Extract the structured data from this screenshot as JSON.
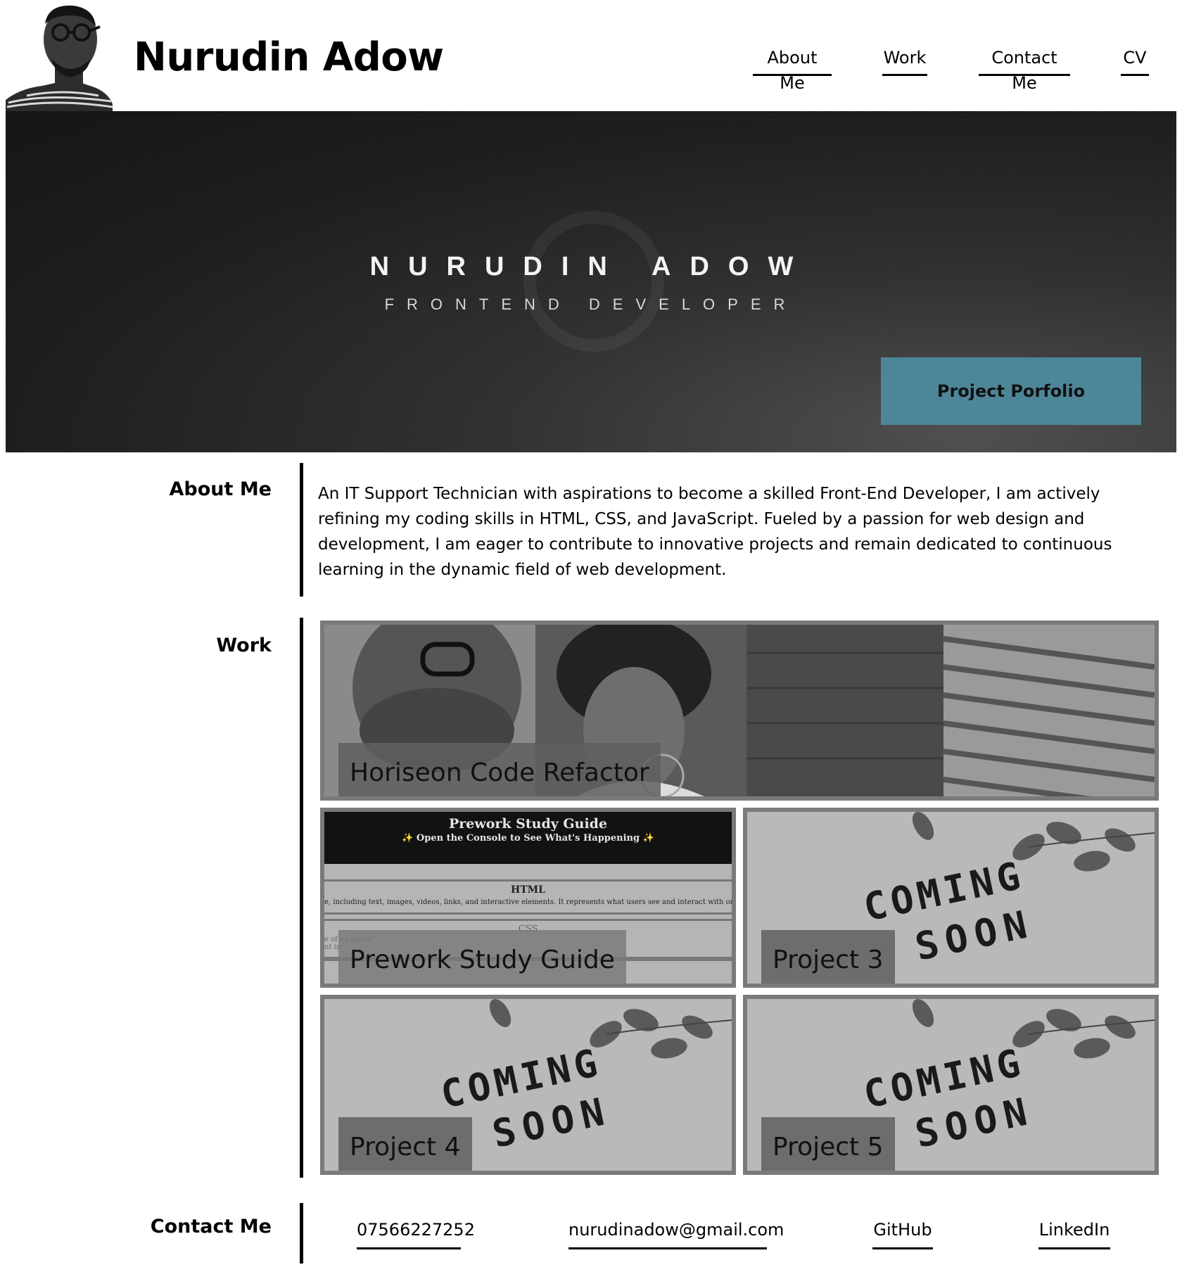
{
  "header": {
    "title": "Nurudin Adow",
    "nav": [
      "About Me",
      "Work",
      "Contact Me",
      "CV"
    ]
  },
  "hero": {
    "name": "NURUDIN ADOW",
    "role": "FRONTEND DEVELOPER",
    "cta_label": "Project Porfolio",
    "cta_color": "#4e8699"
  },
  "about": {
    "heading": "About Me",
    "text": "An IT Support Technician with aspirations to become a skilled Front-End Developer, I am actively refining my coding skills in HTML, CSS, and JavaScript. Fueled by a passion for web design and development, I am eager to contribute to innovative projects and remain dedicated to continuous learning in the dynamic field of web development."
  },
  "work": {
    "heading": "Work",
    "projects": [
      {
        "title": "Horiseon Code Refactor"
      },
      {
        "title": "Prework Study Guide",
        "preview": {
          "title": "Prework Study Guide",
          "subtitle": "✨ Open the Console to See What's Happening ✨",
          "section1": "HTML",
          "section1_text": "e, including text, images, videos, links, and interactive elements. It represents what users see and interact with on the w",
          "section2": "CSS",
          "section2_text_1": "e of its layout",
          "section2_text_2": "nt in"
        }
      },
      {
        "title": "Project 3",
        "image_text": [
          "COMING",
          "SOON"
        ]
      },
      {
        "title": "Project 4",
        "image_text": [
          "COMING",
          "SOON"
        ]
      },
      {
        "title": "Project 5",
        "image_text": [
          "COMING",
          "SOON"
        ]
      }
    ]
  },
  "contact": {
    "heading": "Contact Me",
    "phone": "07566227252",
    "email": "nurudinadow@gmail.com",
    "github": "GitHub",
    "linkedin": "LinkedIn"
  }
}
